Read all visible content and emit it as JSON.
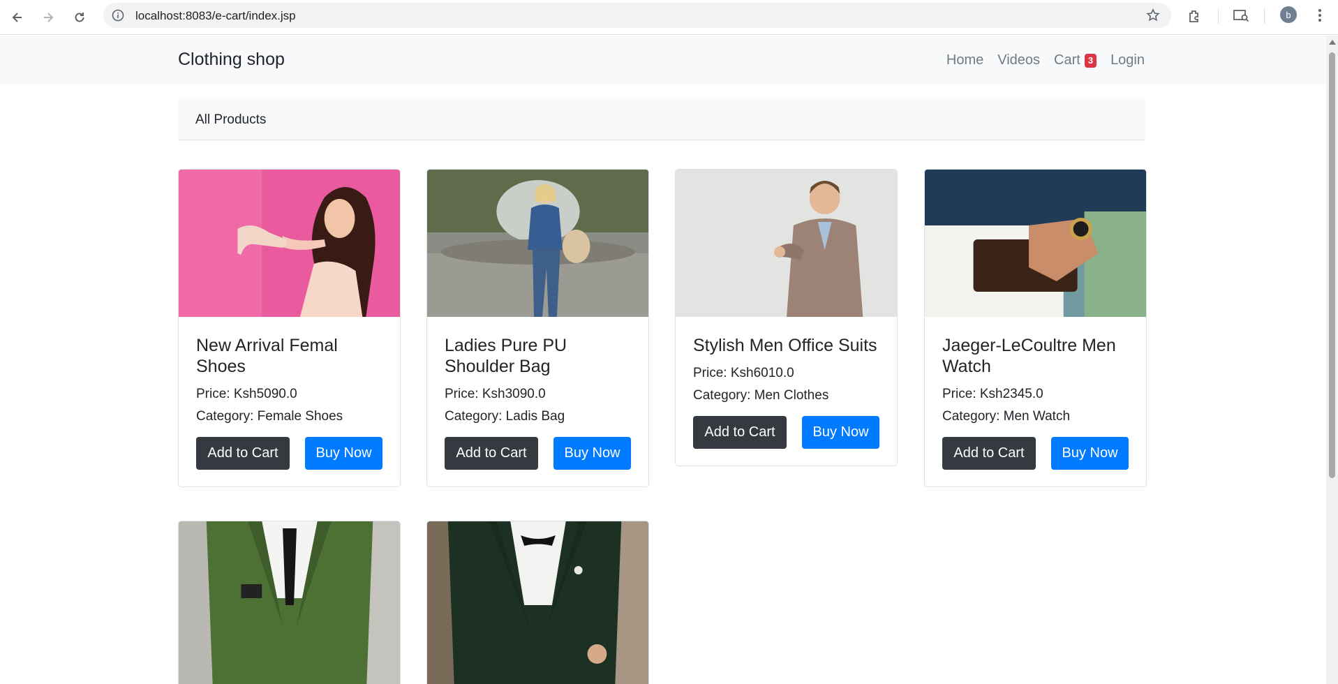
{
  "browser": {
    "url": "localhost:8083/e-cart/index.jsp",
    "profile_initial": "b"
  },
  "navbar": {
    "brand": "Clothing shop",
    "links": {
      "home": "Home",
      "videos": "Videos",
      "cart": "Cart",
      "cart_count": "3",
      "login": "Login"
    }
  },
  "breadcrumb": "All Products",
  "products": [
    {
      "title": "New Arrival Femal Shoes",
      "price": "Price: Ksh5090.0",
      "category": "Category: Female Shoes",
      "add_label": "Add to Cart",
      "buy_label": "Buy Now"
    },
    {
      "title": "Ladies Pure PU Shoulder Bag",
      "price": "Price: Ksh3090.0",
      "category": "Category: Ladis Bag",
      "add_label": "Add to Cart",
      "buy_label": "Buy Now"
    },
    {
      "title": "Stylish Men Office Suits",
      "price": "Price: Ksh6010.0",
      "category": "Category: Men Clothes",
      "add_label": "Add to Cart",
      "buy_label": "Buy Now"
    },
    {
      "title": "Jaeger-LeCoultre Men Watch",
      "price": "Price: Ksh2345.0",
      "category": "Category: Men Watch",
      "add_label": "Add to Cart",
      "buy_label": "Buy Now"
    }
  ],
  "colors": {
    "brand_bar": "#f8f9fa",
    "primary": "#007bff",
    "dark": "#343a40",
    "badge": "#dc3545"
  }
}
